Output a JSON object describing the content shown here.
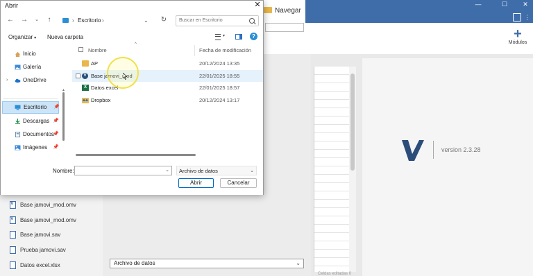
{
  "app": {
    "navigate_label": "Navegar",
    "modules_label": "Módulos",
    "version_text": "version 2.3.28",
    "data_type_select": "Archivo de datos",
    "status_text": "Celdas editadas 0",
    "brand_color": "#3e6da9",
    "recent_files": [
      {
        "name": "Base jamovi_mod.omv",
        "icon": "jamovi-file-icon"
      },
      {
        "name": "Base jamovi_mod.omv",
        "icon": "jamovi-file-icon"
      },
      {
        "name": "Base jamovi.sav",
        "icon": "data-file-icon"
      },
      {
        "name": "Prueba jamovi.sav",
        "icon": "data-file-icon"
      },
      {
        "name": "Datos excel.xlsx",
        "icon": "data-file-icon"
      }
    ]
  },
  "dialog": {
    "title": "Abrir",
    "close_glyph": "✕",
    "address": {
      "location": "Escritorio",
      "chevron": "›"
    },
    "search_placeholder": "Buscar en Escritorio",
    "toolbar": {
      "organize": "Organizar",
      "new_folder": "Nueva carpeta"
    },
    "nav_items": [
      {
        "label": "Inicio",
        "icon": "home-icon"
      },
      {
        "label": "Galería",
        "icon": "gallery-icon"
      },
      {
        "label": "OneDrive",
        "icon": "cloud-icon"
      },
      {
        "label": "Escritorio",
        "icon": "desktop-icon",
        "selected": true
      },
      {
        "label": "Descargas",
        "icon": "download-icon"
      },
      {
        "label": "Documentos",
        "icon": "documents-icon"
      },
      {
        "label": "Imágenes",
        "icon": "images-icon"
      }
    ],
    "columns": {
      "name": "Nombre",
      "date": "Fecha de modificación"
    },
    "files": [
      {
        "name": "AP",
        "date": "20/12/2024 13:35",
        "icon": "folder-icon"
      },
      {
        "name": "Base jamovi_mod",
        "date": "22/01/2025 18:55",
        "icon": "jamovi-icon",
        "hover": true
      },
      {
        "name": "Datos excel",
        "date": "22/01/2025 18:57",
        "icon": "excel-icon"
      },
      {
        "name": "Dropbox",
        "date": "20/12/2024 13:17",
        "icon": "dropbox-icon"
      }
    ],
    "filename_label": "Nombre:",
    "filename_value": "",
    "filetype": "Archivo de datos",
    "open_button": "Abrir",
    "cancel_button": "Cancelar",
    "accent_color": "#0067c0"
  }
}
